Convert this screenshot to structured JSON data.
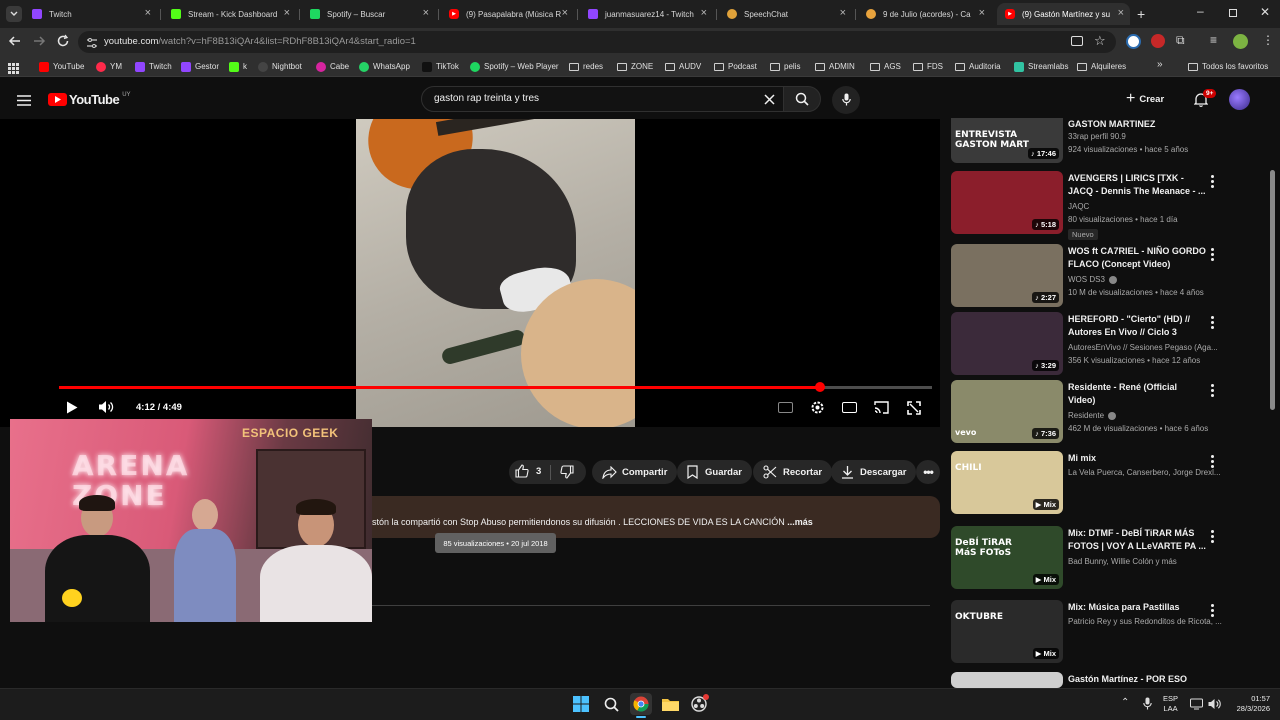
{
  "browser": {
    "tabs": [
      {
        "label": "Twitch",
        "icon": "twitch-icon",
        "color": "#9146ff"
      },
      {
        "label": "Stream - Kick Dashboard",
        "icon": "kick-icon",
        "color": "#53fc18"
      },
      {
        "label": "Spotify – Buscar",
        "icon": "spotify-icon",
        "color": "#1ed760"
      },
      {
        "label": "(9) Pasapalabra (Música R",
        "icon": "youtube-icon",
        "color": "#ff0000"
      },
      {
        "label": "juanmasuarez14 - Twitch",
        "icon": "twitch-icon",
        "color": "#9146ff"
      },
      {
        "label": "SpeechChat",
        "icon": "speechchat-icon",
        "color": "#e0a23a"
      },
      {
        "label": "9 de Julio (acordes) - Ca",
        "icon": "shield-icon",
        "color": "#e8a33d"
      },
      {
        "label": "(9) Gastón Martínez y su",
        "icon": "youtube-icon",
        "color": "#ff0000"
      }
    ],
    "url": "youtube.com/watch?v=hF8B13iQAr4&list=RDhF8B13iQAr4&start_radio=1",
    "url_host": "youtube.com",
    "url_path": "/watch?v=hF8B13iQAr4&list=RDhF8B13iQAr4&start_radio=1",
    "bookmarks": [
      {
        "label": "YouTube",
        "icon": "youtube-icon",
        "color": "#ff0000"
      },
      {
        "label": "YM",
        "icon": "ym-icon",
        "color": "#ff2a4a"
      },
      {
        "label": "Twitch",
        "icon": "twitch-icon",
        "color": "#9146ff"
      },
      {
        "label": "Gestor",
        "icon": "twitch-icon",
        "color": "#9146ff"
      },
      {
        "label": "k",
        "icon": "kick-icon",
        "color": "#53fc18"
      },
      {
        "label": "Nightbot",
        "icon": "nightbot-icon",
        "color": "#444444"
      },
      {
        "label": "Cabe",
        "icon": "instagram-icon",
        "color": "#d6249f"
      },
      {
        "label": "WhatsApp",
        "icon": "whatsapp-icon",
        "color": "#25d366"
      },
      {
        "label": "TikTok",
        "icon": "tiktok-icon",
        "color": "#111111"
      },
      {
        "label": "Spotify – Web Player",
        "icon": "spotify-icon",
        "color": "#1ed760"
      },
      {
        "label": "redes",
        "icon": "folder-icon"
      },
      {
        "label": "ZONE",
        "icon": "folder-icon"
      },
      {
        "label": "AUDV",
        "icon": "folder-icon"
      },
      {
        "label": "Podcast",
        "icon": "folder-icon"
      },
      {
        "label": "pelis",
        "icon": "folder-icon"
      },
      {
        "label": "ADMIN",
        "icon": "folder-icon"
      },
      {
        "label": "AGS",
        "icon": "folder-icon"
      },
      {
        "label": "FDS",
        "icon": "folder-icon"
      },
      {
        "label": "Auditoria",
        "icon": "folder-icon"
      },
      {
        "label": "Streamlabs",
        "icon": "streamlabs-icon",
        "color": "#31c3a2"
      },
      {
        "label": "Alquileres",
        "icon": "folder-icon"
      }
    ],
    "all_bookmarks_label": "Todos los favoritos"
  },
  "youtube": {
    "logo_text": "YouTube",
    "country_code": "UY",
    "search_value": "gaston rap treinta y tres",
    "create_label": "Crear",
    "notifications_count": "9+",
    "player": {
      "time_label": "4:12 / 4:49",
      "progress": 0.872
    },
    "actions": {
      "like_count": "3",
      "share_label": "Compartir",
      "save_label": "Guardar",
      "clip_label": "Recortar",
      "download_label": "Descargar"
    },
    "description": {
      "text": "stón  la compartió  con Stop Abuso permitiendonos su difusión . LECCIONES DE VIDA ES LA CANCIÓN",
      "more_label": "...más",
      "tooltip": "85 visualizaciones • 20 jul 2018"
    },
    "webcam_sign": "ARENA ZONE",
    "webcam_sign_2": "ESPACIO GEEK",
    "recommendations": [
      {
        "title": "GASTON MARTINEZ",
        "channel": "33rap perfil 90.9",
        "stats": "924 visualizaciones • hace 5 años",
        "duration": "17:46",
        "thumb_color": "#3a3a3a",
        "thumb_text": "ENTREVISTA GASTON MART"
      },
      {
        "title": "AVENGERS | LIRICS [TXK - JACQ - Dennis The Meanace - ...",
        "channel": "JAQC",
        "stats": "80 visualizaciones • hace 1 día",
        "duration": "5:18",
        "badge": "Nuevo",
        "thumb_color": "#8b1e2b"
      },
      {
        "title": "WOS ft CA7RIEL - NIÑO GORDO FLACO (Concept Video)",
        "channel": "WOS DS3",
        "stats": "10 M de visualizaciones • hace 4 años",
        "duration": "2:27",
        "thumb_color": "#7a7060"
      },
      {
        "title": "HEREFORD - \"Cierto\" (HD) // Autores En Vivo // Ciclo 3",
        "channel": "AutoresEnVivo // Sesiones Pegaso (Aga...",
        "stats": "356 K visualizaciones • hace 12 años",
        "duration": "3:29",
        "thumb_color": "#3b2a3a"
      },
      {
        "title": "Residente - René (Official Video)",
        "channel": "Residente",
        "stats": "462 M de visualizaciones • hace 6 años",
        "duration": "7:36",
        "thumb_color": "#8a8a6a",
        "thumb_text": "vevo"
      },
      {
        "title": "Mi mix",
        "channel": "La Vela Puerca, Canserbero, Jorge Drexl...",
        "stats": "",
        "duration": "Mix",
        "thumb_color": "#d8c89a",
        "thumb_text": "CHILI"
      },
      {
        "title": "Mix: DTMF - DeBÍ TiRAR MÁS FOTOS | VOY A LLeVARTE PA ...",
        "channel": "Bad Bunny, Willie Colón y más",
        "stats": "",
        "duration": "Mix",
        "thumb_color": "#2f4a2a",
        "thumb_text": "DeBÍ TiRAR MáS FOToS"
      },
      {
        "title": "Mix: Música para Pastillas",
        "channel": "Patricio Rey y sus Redonditos de Ricota, ...",
        "stats": "",
        "duration": "Mix",
        "thumb_color": "#2a2a2a",
        "thumb_text": "OKTUBRE"
      },
      {
        "title": "Gastón Martínez - POR ESO",
        "channel": "",
        "stats": "",
        "duration": "",
        "thumb_color": "#cfcfcf"
      }
    ]
  },
  "taskbar": {
    "lang_top": "ESP",
    "lang_bottom": "LAA",
    "time": "01:57",
    "date": "28/3/2026"
  }
}
